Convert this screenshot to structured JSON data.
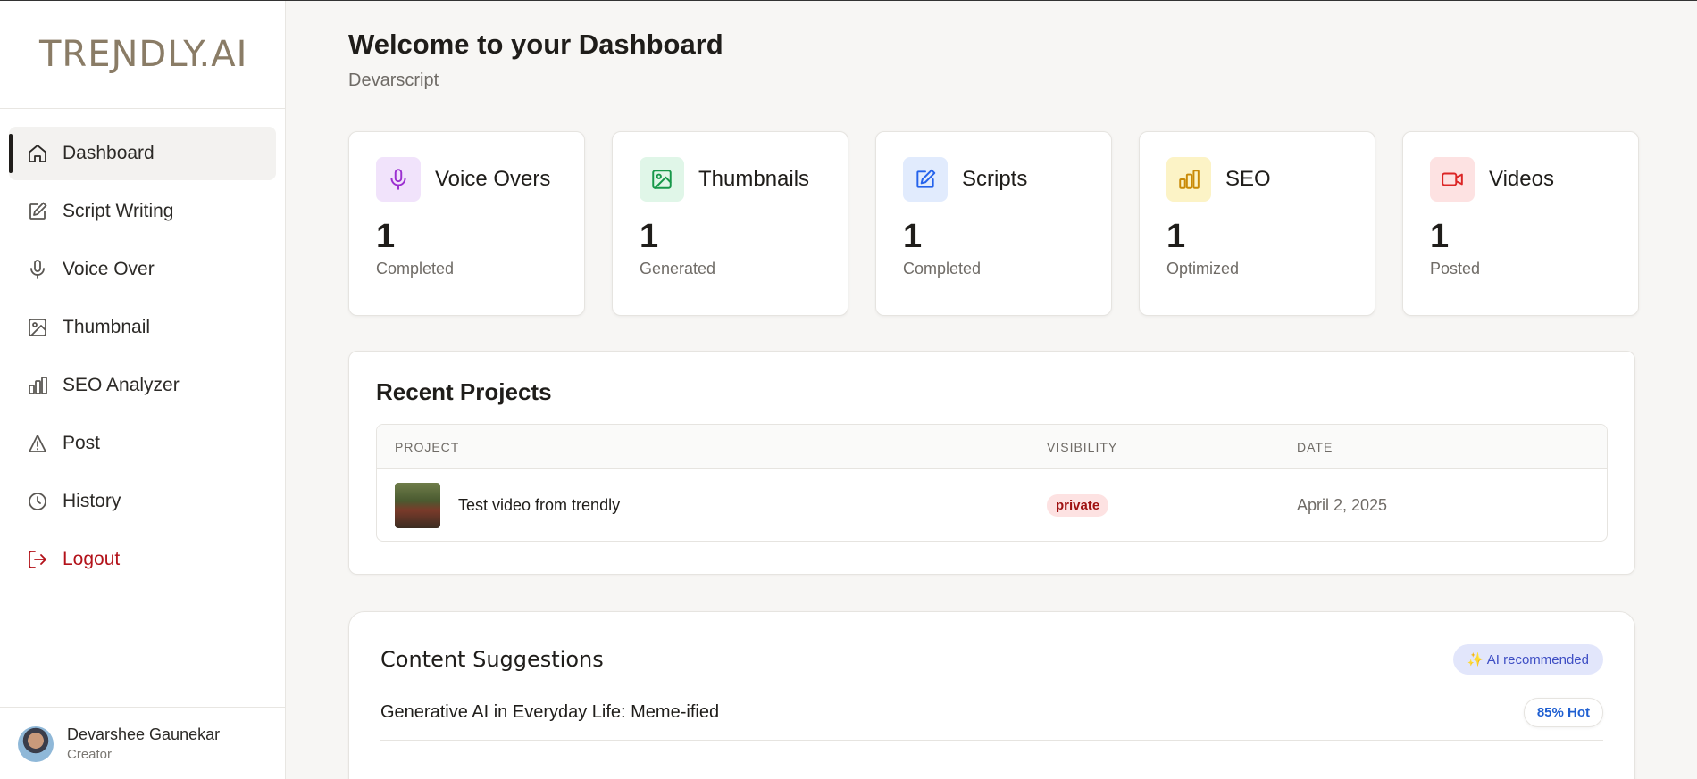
{
  "brand": {
    "logo": "TREƝDLY.AI"
  },
  "sidebar": {
    "items": [
      {
        "label": "Dashboard",
        "icon": "home-icon"
      },
      {
        "label": "Script Writing",
        "icon": "edit-icon"
      },
      {
        "label": "Voice Over",
        "icon": "mic-icon"
      },
      {
        "label": "Thumbnail",
        "icon": "image-icon"
      },
      {
        "label": "SEO Analyzer",
        "icon": "bar-chart-icon"
      },
      {
        "label": "Post",
        "icon": "navigation-icon"
      },
      {
        "label": "History",
        "icon": "clock-icon"
      },
      {
        "label": "Logout",
        "icon": "logout-icon"
      }
    ]
  },
  "profile": {
    "name": "Devarshee Gaunekar",
    "role": "Creator"
  },
  "header": {
    "title": "Welcome to your Dashboard",
    "subtitle": "Devarscript"
  },
  "stats": [
    {
      "label": "Voice Overs",
      "value": "1",
      "desc": "Completed",
      "icon": "mic-icon",
      "color": "#9b2fd0",
      "bg": "#f1e3fb"
    },
    {
      "label": "Thumbnails",
      "value": "1",
      "desc": "Generated",
      "icon": "image-icon",
      "color": "#17984a",
      "bg": "#e0f6e8"
    },
    {
      "label": "Scripts",
      "value": "1",
      "desc": "Completed",
      "icon": "edit-icon",
      "color": "#2563eb",
      "bg": "#e1ebfd"
    },
    {
      "label": "SEO",
      "value": "1",
      "desc": "Optimized",
      "icon": "bar-chart-icon",
      "color": "#c98a07",
      "bg": "#fcf3c6"
    },
    {
      "label": "Videos",
      "value": "1",
      "desc": "Posted",
      "icon": "video-icon",
      "color": "#dc2626",
      "bg": "#fde2e2"
    }
  ],
  "projects": {
    "title": "Recent Projects",
    "columns": [
      "PROJECT",
      "VISIBILITY",
      "DATE"
    ],
    "rows": [
      {
        "name": "Test video from trendly",
        "visibility": "private",
        "date": "April 2, 2025"
      }
    ]
  },
  "suggestions": {
    "title": "Content Suggestions",
    "badge": "✨ AI recommended",
    "items": [
      {
        "title": "Generative AI in Everyday Life: Meme-ified",
        "hot": "85% Hot"
      }
    ]
  }
}
